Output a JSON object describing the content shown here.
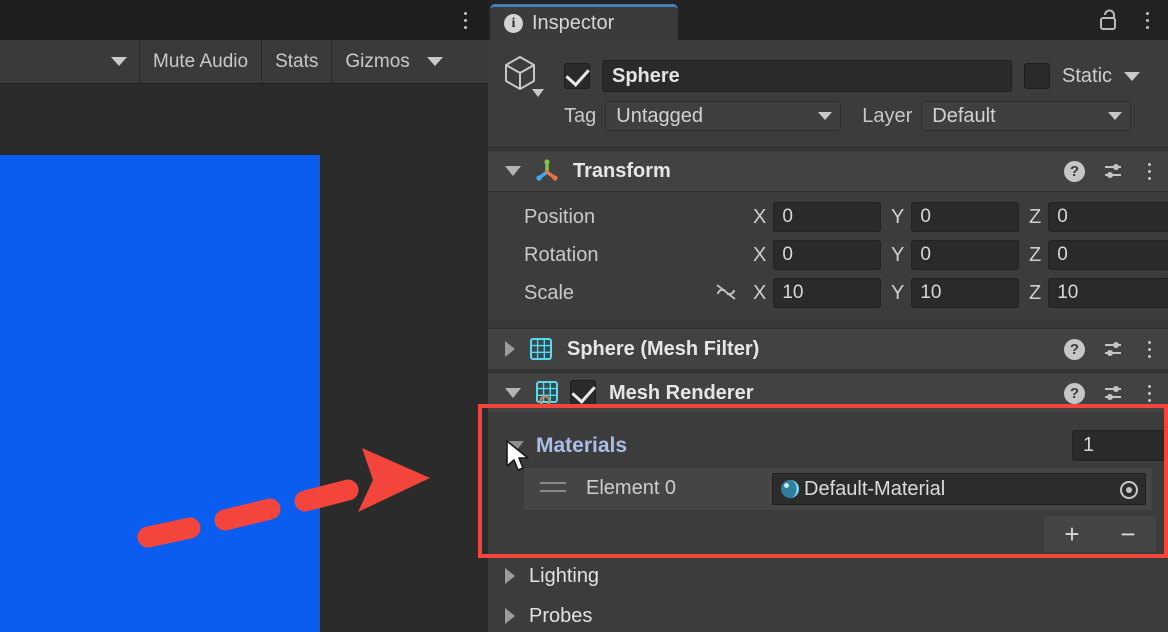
{
  "scene_toolbar": {
    "view_dropdown_label": "",
    "buttons": [
      {
        "label": "Mute Audio",
        "name": "mute-audio-button"
      },
      {
        "label": "Stats",
        "name": "stats-button"
      },
      {
        "label": "Gizmos",
        "name": "gizmos-button"
      }
    ]
  },
  "scene": {
    "object_color": "#0b5df0"
  },
  "annotation": {
    "arrow_color": "#f3453c",
    "highlight_color": "#f3453c"
  },
  "inspector": {
    "tab_label": "Inspector",
    "tab_icon": "info-icon",
    "lock_icon": "padlock-unlocked-icon",
    "menu_icon": "kebab-menu-icon",
    "accent_color": "#4a7ebb",
    "header": {
      "enabled_checkbox": true,
      "object_name": "Sphere",
      "static_label": "Static",
      "static_checked": false,
      "tag_label": "Tag",
      "tag_value": "Untagged",
      "layer_label": "Layer",
      "layer_value": "Default"
    },
    "components": [
      {
        "name": "transform",
        "title": "Transform",
        "expanded": true,
        "enabled_toggle": false,
        "icon": "transform-axis-icon",
        "rows": [
          {
            "label": "Position",
            "linked": false,
            "axes": [
              {
                "axis": "X",
                "value": "0"
              },
              {
                "axis": "Y",
                "value": "0"
              },
              {
                "axis": "Z",
                "value": "0"
              }
            ]
          },
          {
            "label": "Rotation",
            "linked": false,
            "axes": [
              {
                "axis": "X",
                "value": "0"
              },
              {
                "axis": "Y",
                "value": "0"
              },
              {
                "axis": "Z",
                "value": "0"
              }
            ]
          },
          {
            "label": "Scale",
            "linked": true,
            "link_icon": "broken-chain-icon",
            "axes": [
              {
                "axis": "X",
                "value": "10"
              },
              {
                "axis": "Y",
                "value": "10"
              },
              {
                "axis": "Z",
                "value": "10"
              }
            ]
          }
        ]
      },
      {
        "name": "mesh-filter",
        "title": "Sphere (Mesh Filter)",
        "expanded": false,
        "enabled_toggle": false,
        "icon": "mesh-grid-icon"
      },
      {
        "name": "mesh-renderer",
        "title": "Mesh Renderer",
        "expanded": true,
        "enabled_toggle": true,
        "enabled_checked": true,
        "icon": "mesh-renderer-icon"
      }
    ],
    "materials": {
      "label": "Materials",
      "label_color": "#a8bee8",
      "count": "1",
      "element_label": "Element 0",
      "element_value": "Default-Material",
      "element_icon": "material-sphere-icon",
      "picker_icon": "object-picker-icon",
      "add_label": "+",
      "remove_label": "−",
      "drag_handle_icon": "drag-handle-icon"
    },
    "sub_sections": [
      {
        "label": "Lighting",
        "expanded": false
      },
      {
        "label": "Probes",
        "expanded": false
      }
    ],
    "icons": {
      "help": "?",
      "preset": "preset-settings-icon",
      "kebab": "kebab-menu-icon"
    }
  }
}
